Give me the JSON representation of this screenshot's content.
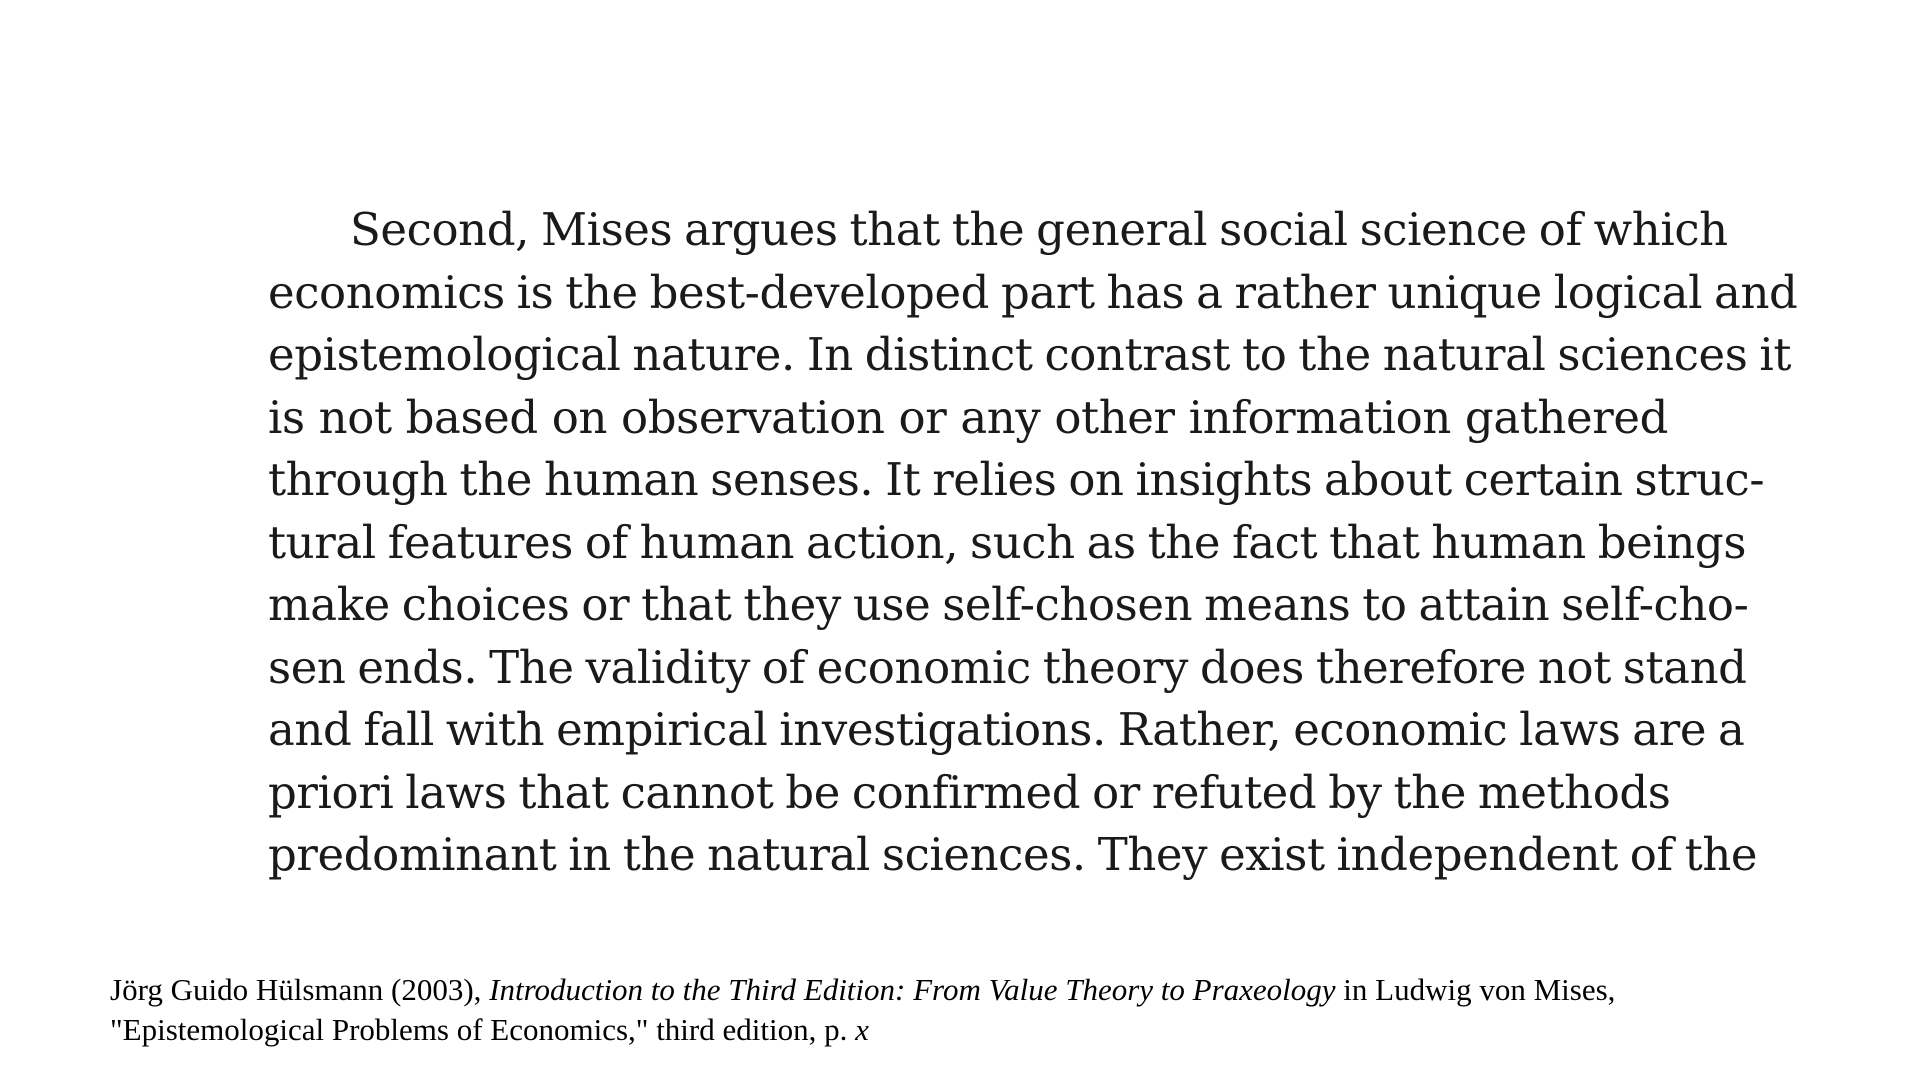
{
  "quote": {
    "lines": [
      "Second, Mises argues that the general social science of which",
      "economics is the best-developed part has a rather unique logical and",
      "epistemological nature. In distinct contrast to the natural sciences it",
      "is not based on observation or any other information gathered",
      "through the human senses. It relies on insights about certain struc-",
      "tural features of human action, such as the fact that human beings",
      "make choices or that they use self-chosen means to attain self-cho-",
      "sen ends. The validity of economic theory does therefore not stand",
      "and fall with empirical investigations. Rather, economic laws are a",
      "priori laws that cannot be confirmed or refuted by the methods",
      "predominant in the natural sciences. They exist independent of the"
    ]
  },
  "citation": {
    "author_year": "Jörg Guido Hülsmann (2003), ",
    "work_title": "Introduction to the Third Edition: From Value Theory to Praxeology",
    "in_text": " in Ludwig von Mises,",
    "source": "\"Epistemological Problems of Economics,\" third edition, p. ",
    "page": "x"
  }
}
